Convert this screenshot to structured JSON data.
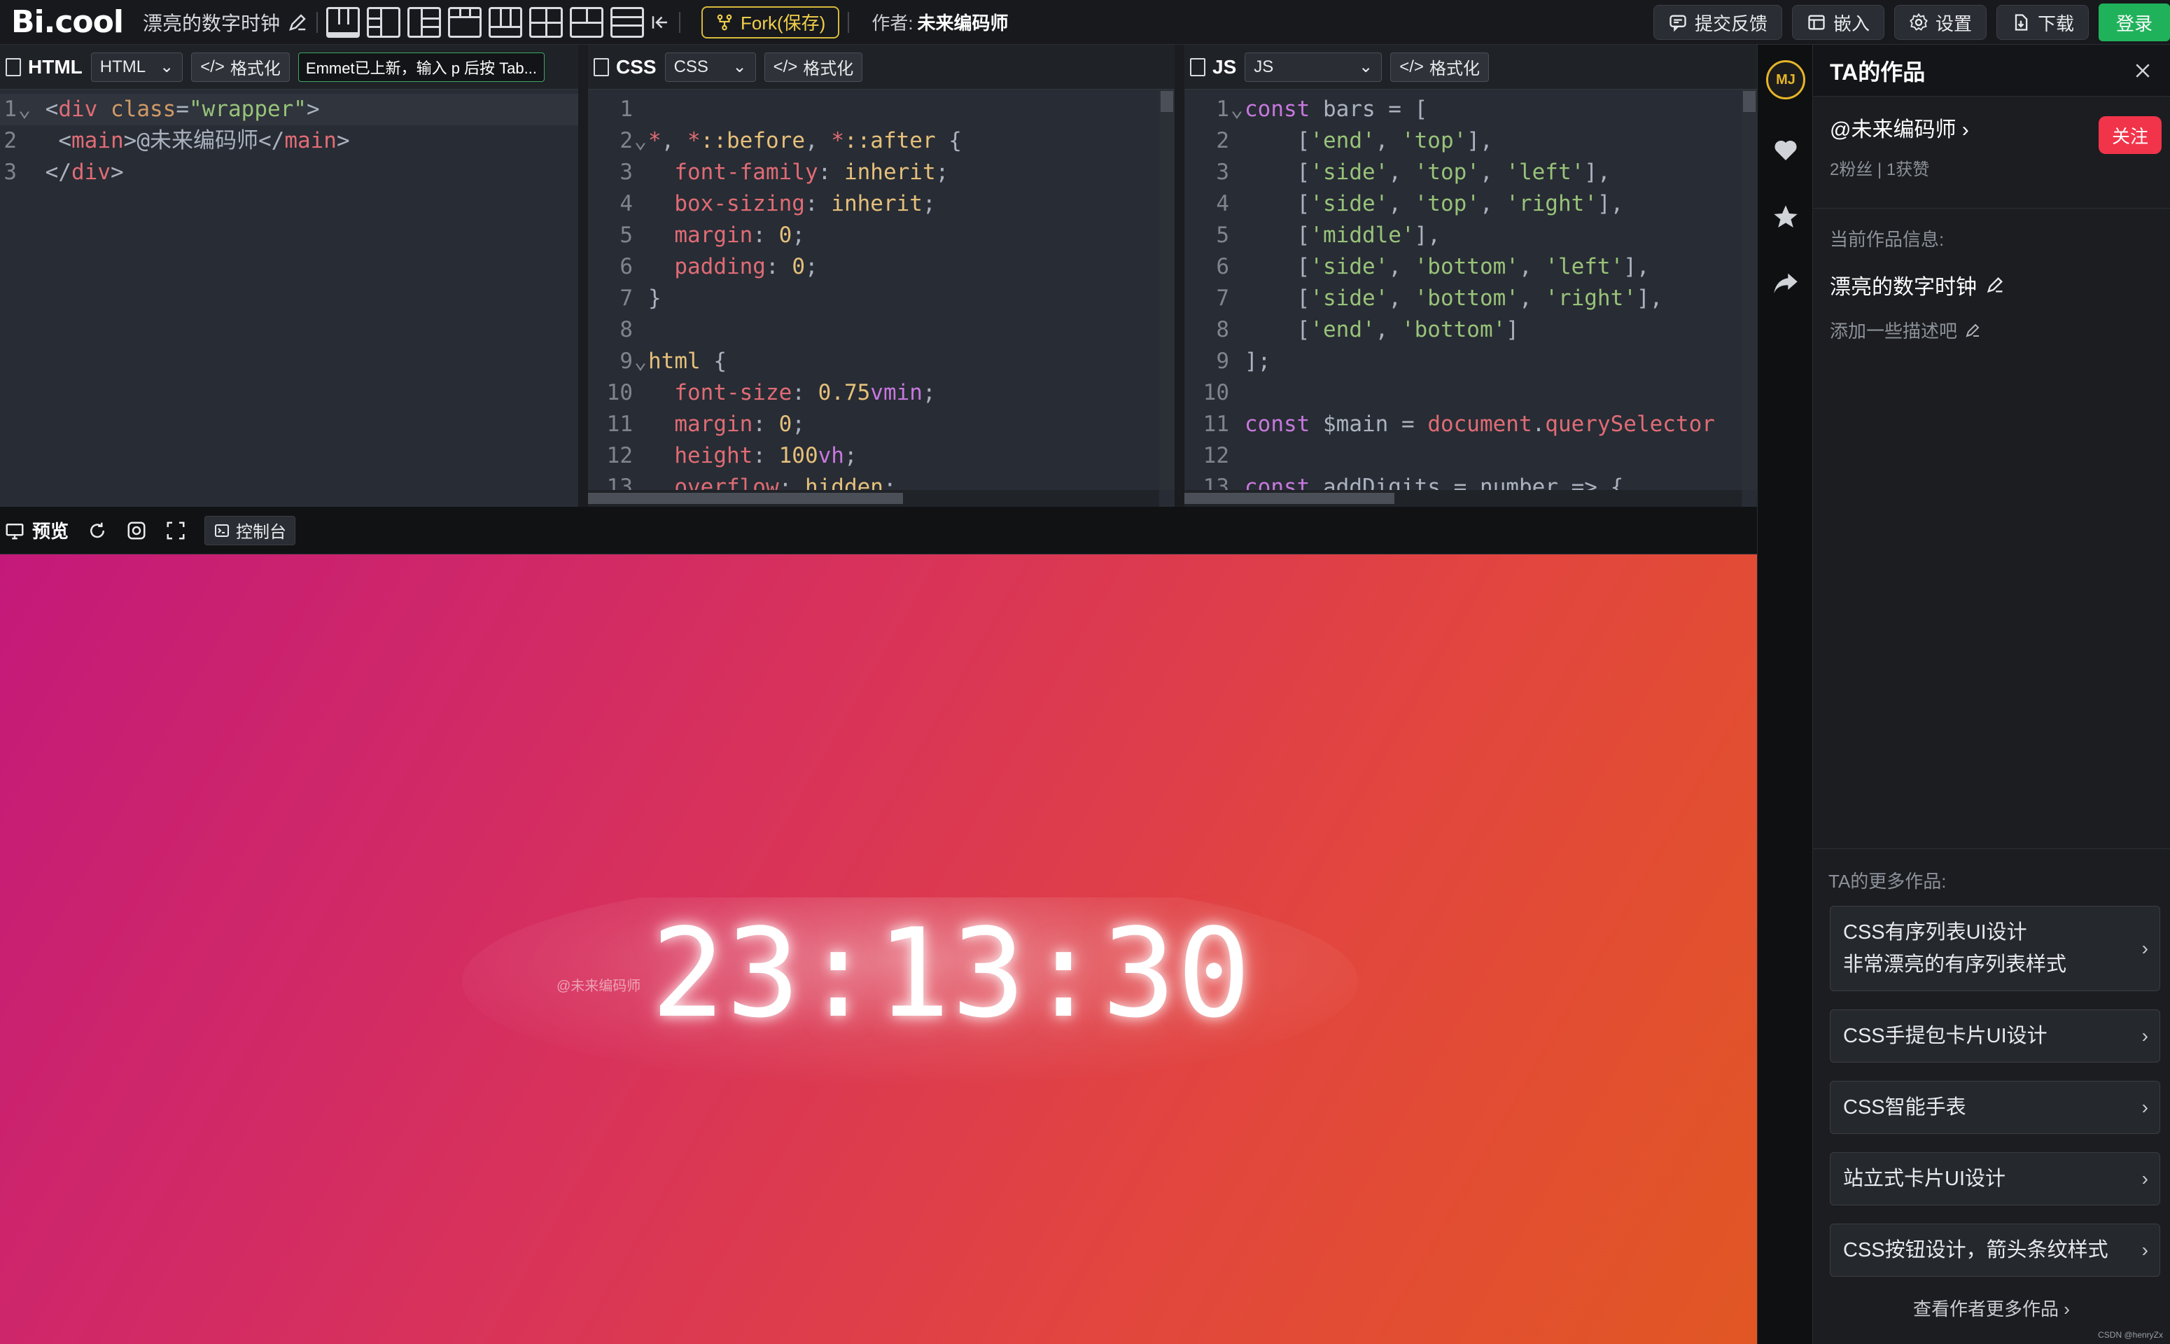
{
  "header": {
    "brand": "Bi.cool",
    "work_title": "漂亮的数字时钟",
    "fork_label": "Fork(保存)",
    "author_prefix": "作者:",
    "author_name": "未来编码师",
    "buttons": {
      "feedback": "提交反馈",
      "embed": "嵌入",
      "settings": "设置",
      "download": "下载",
      "login": "登录"
    }
  },
  "editors": {
    "html": {
      "label": "HTML",
      "select": "HTML",
      "format": "格式化",
      "emmet": "Emmet已上新，输入 p 后按 Tab..."
    },
    "css": {
      "label": "CSS",
      "select": "CSS",
      "format": "格式化"
    },
    "js": {
      "label": "JS",
      "select": "JS",
      "format": "格式化"
    }
  },
  "preview": {
    "label": "预览",
    "console": "控制台",
    "clock_time": "23:13:30",
    "watermark": "@未来编码师"
  },
  "sidebar": {
    "title": "TA的作品",
    "author": "@未来编码师 ›",
    "follow": "关注",
    "stats": "2粉丝  |  1获赞",
    "info_label": "当前作品信息:",
    "info_title": "漂亮的数字时钟",
    "info_desc": "添加一些描述吧",
    "more_label": "TA的更多作品:",
    "works": [
      {
        "line1": "CSS有序列表UI设计",
        "line2": "非常漂亮的有序列表样式"
      },
      {
        "line1": "CSS手提包卡片UI设计"
      },
      {
        "line1": "CSS智能手表"
      },
      {
        "line1": "站立式卡片UI设计"
      },
      {
        "line1": "CSS按钮设计，箭头条纹样式"
      }
    ],
    "view_more": "查看作者更多作品 ›",
    "avatar_text": "MJ",
    "csdn_watermark": "CSDN @henryZx"
  },
  "colors": {
    "accent_green": "#20b25b",
    "fork_yellow": "#f0cf4a",
    "follow_red": "#f1344a"
  }
}
